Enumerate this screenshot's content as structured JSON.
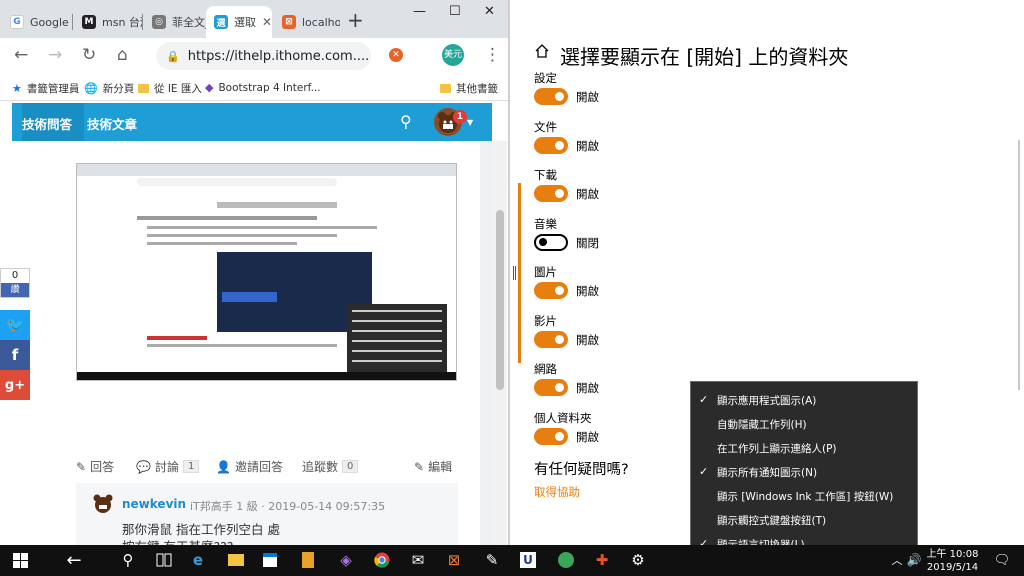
{
  "browser": {
    "tabs": [
      {
        "label": "Google",
        "fav_color": "#4285f4",
        "fav_letter": "G"
      },
      {
        "label": "msn 台灣",
        "fav_color": "#222222",
        "fav_letter": "M"
      },
      {
        "label": "菲全文_",
        "fav_color": "#666666",
        "fav_letter": "◎"
      },
      {
        "label": "選取",
        "fav_color": "#1e9ed5",
        "fav_letter": "選"
      },
      {
        "label": "localhost",
        "fav_color": "#e8632a",
        "fav_letter": "⊠"
      }
    ],
    "new_tab": "+",
    "window_controls": {
      "minimize": "—",
      "maximize": "☐",
      "close": "✕"
    },
    "url": "https://ithelp.ithome.com....",
    "profile_label": "美元",
    "bookmarks": [
      {
        "label": "書籤管理員",
        "icon": "star-icon"
      },
      {
        "label": "新分頁",
        "icon": "globe-icon"
      },
      {
        "label": "從 IE 匯入",
        "icon": "folder-icon"
      },
      {
        "label": "Bootstrap 4 Interf...",
        "icon": "cube-icon"
      }
    ],
    "other_bookmarks": "其他書籤"
  },
  "site": {
    "nav": [
      "技術問答",
      "技術文章"
    ],
    "notification_count": "1",
    "like_count": "0",
    "like_label": "讚",
    "actions": [
      {
        "icon": "edit-icon",
        "label": "回答"
      },
      {
        "icon": "comment-icon",
        "label": "討論",
        "count": "1"
      },
      {
        "icon": "invite-icon",
        "label": "邀請回答"
      },
      {
        "icon": "",
        "label": "追蹤數",
        "count": "0"
      }
    ],
    "edit_label": "編輯",
    "answer": {
      "user": "newkevin",
      "meta": "iT邦高手 1 級 · 2019-05-14 09:57:35",
      "line1": "那你滑鼠 指在工作列空白 處",
      "line2": "按右鍵 有工甚麼???"
    }
  },
  "settings": {
    "title": "選擇要顯示在 [開始] 上的資料夾",
    "items": [
      {
        "label": "設定",
        "state": "開啟",
        "on": true
      },
      {
        "label": "文件",
        "state": "開啟",
        "on": true
      },
      {
        "label": "下載",
        "state": "開啟",
        "on": true
      },
      {
        "label": "音樂",
        "state": "關閉",
        "on": false
      },
      {
        "label": "圖片",
        "state": "開啟",
        "on": true
      },
      {
        "label": "影片",
        "state": "開啟",
        "on": true
      },
      {
        "label": "網路",
        "state": "開啟",
        "on": true
      },
      {
        "label": "個人資料夾",
        "state": "開啟",
        "on": true
      }
    ],
    "question": "有任何疑問嗎?",
    "help_link": "取得協助",
    "accent_color": "#e67e10"
  },
  "context_menu": [
    {
      "label": "顯示應用程式圖示(A)",
      "checked": true
    },
    {
      "label": "自動隱藏工作列(H)",
      "checked": false
    },
    {
      "label": "在工作列上顯示連絡人(P)",
      "checked": false
    },
    {
      "label": "顯示所有通知圖示(N)",
      "checked": true
    },
    {
      "label": "顯示 [Windows Ink 工作區] 按鈕(W)",
      "checked": false
    },
    {
      "label": "顯示觸控式鍵盤按鈕(T)",
      "checked": false
    },
    {
      "label": "顯示語言切換器(L)",
      "checked": true
    }
  ],
  "taskbar": {
    "time": "上午 10:08",
    "date": "2019/5/14"
  }
}
